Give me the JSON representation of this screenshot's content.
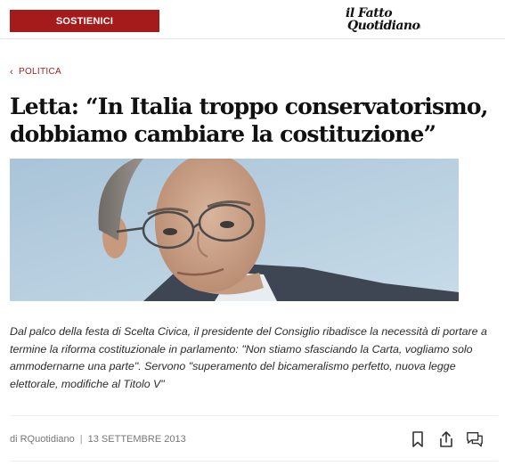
{
  "header": {
    "support_label": "SOSTIENICI",
    "logo_line1": "il Fatto",
    "logo_line2": "Quotidiano",
    "logo_mark": "it"
  },
  "article": {
    "category": "POLITICA",
    "title": "Letta: “In Italia troppo conservatorismo, dobbiamo cambiare la costituzione”",
    "summary": "Dal palco della festa di Scelta Civica, il presidente del Consiglio ribadisce la necessità di portare a termine la riforma costituzionale in parlamento: \"Non stiamo sfasciando la Carta, vogliamo solo ammodernarne una parte\". Servono \"superamento del bicameralismo perfetto, nuova legge elettorale, modifiche al Titolo V\"",
    "author": "di RQuotidiano",
    "date": "13 SETTEMBRE 2013"
  },
  "icons": {
    "bookmark": "bookmark-icon",
    "share": "share-icon",
    "comments": "comments-icon"
  },
  "colors": {
    "accent": "#a51b1b",
    "text": "#111111",
    "muted": "#777777"
  }
}
